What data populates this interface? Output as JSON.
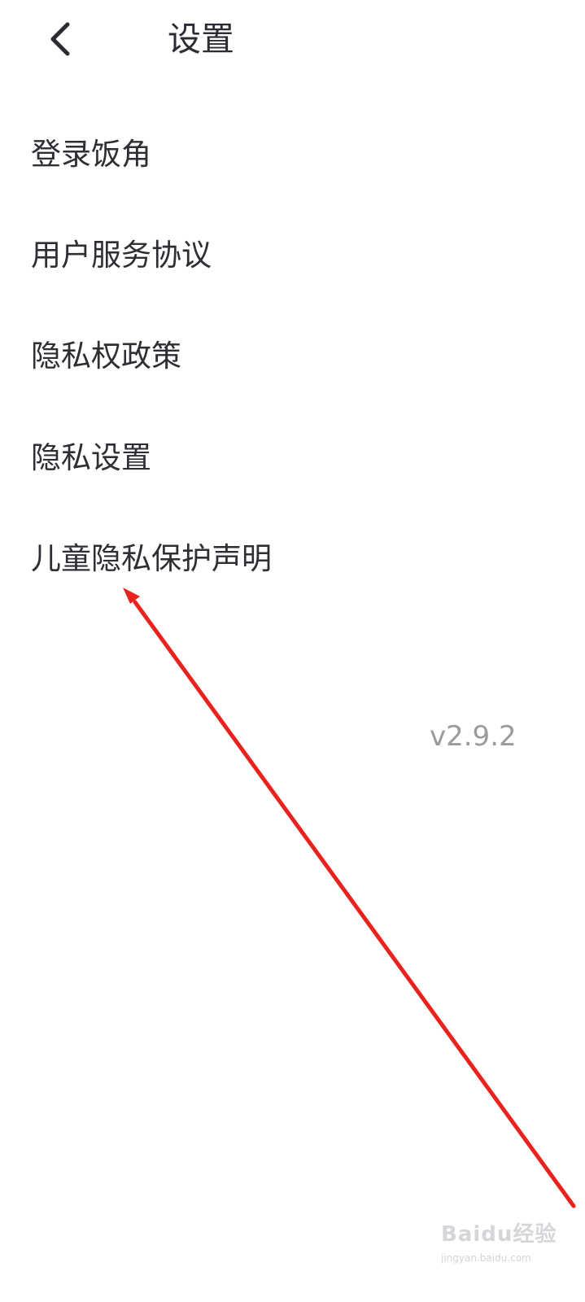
{
  "header": {
    "title": "设置",
    "back_icon": "chevron-left-icon"
  },
  "menu": {
    "items": [
      {
        "label": "登录饭角"
      },
      {
        "label": "用户服务协议"
      },
      {
        "label": "隐私权政策"
      },
      {
        "label": "隐私设置"
      },
      {
        "label": "儿童隐私保护声明"
      }
    ]
  },
  "version": "v2.9.2",
  "annotation": {
    "type": "arrow",
    "color": "#e8231e"
  },
  "watermark": {
    "brand": "Baidu经验",
    "url": "jingyan.baidu.com"
  }
}
